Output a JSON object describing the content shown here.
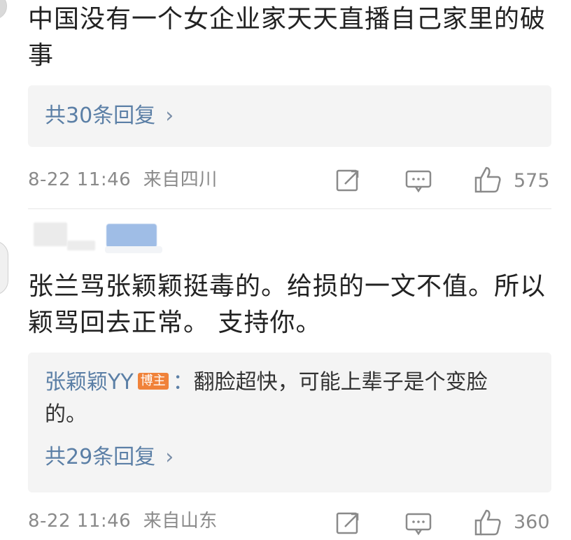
{
  "comment1": {
    "text": "中国没有一个女企业家天天直播自己家里的破事",
    "replies_label": "共30条回复",
    "time": "8-22 11:46",
    "location": "来自四川",
    "likes": "575"
  },
  "comment2": {
    "text": "张兰骂张颖颖挺毒的。给损的一文不值。所以颖骂回去正常。 支持你。",
    "author_reply": {
      "name": "张颖颖YY",
      "badge": "博主",
      "separator": "：",
      "text": "翻脸超快，可能上辈子是个变脸的。"
    },
    "replies_label": "共29条回复",
    "time": "8-22 11:46",
    "location": "来自山东",
    "likes": "360"
  },
  "icons": {
    "share": "share-icon",
    "comment": "comment-icon",
    "like": "thumbs-up-icon",
    "chevron": "chevron-right-icon"
  },
  "colors": {
    "link": "#5b7fa6",
    "meta": "#8a8a8a",
    "badge": "#f0823a",
    "reply_bg": "#f4f4f4"
  }
}
